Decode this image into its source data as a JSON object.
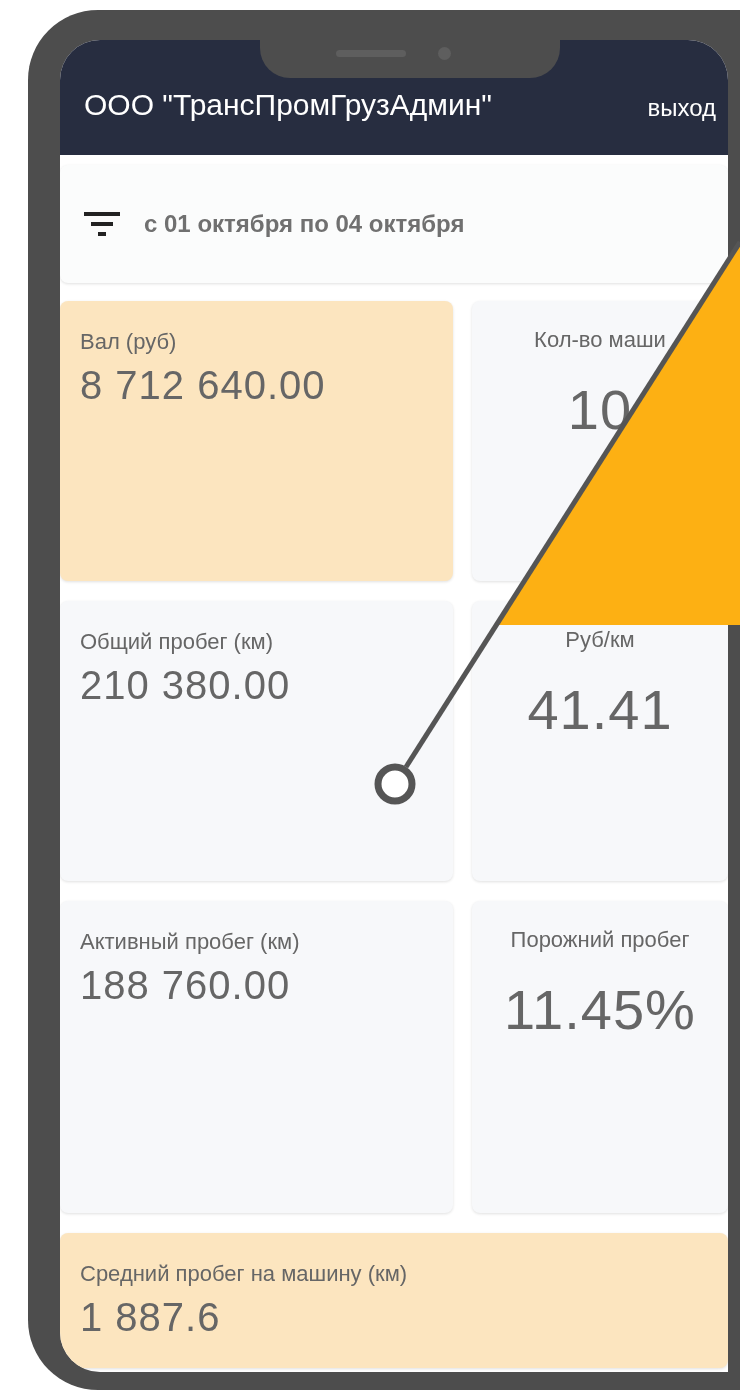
{
  "header": {
    "title": "ООО \"ТрансПромГрузАдмин\"",
    "logout": "выход"
  },
  "filter": {
    "period": "с 01 октября по 04 октября"
  },
  "cards": [
    {
      "label": "Вал (руб)",
      "value": "8 712 640.00",
      "highlighted": true
    },
    {
      "label": "Кол-во маши",
      "value": "10",
      "highlighted": false
    },
    {
      "label": "Общий пробег (км)",
      "value": "210 380.00",
      "highlighted": false
    },
    {
      "label": "Руб/км",
      "value": "41.41",
      "highlighted": false
    },
    {
      "label": "Активный пробег (км)",
      "value": "188 760.00",
      "highlighted": false
    },
    {
      "label": "Порожний пробег",
      "value": "11.45%",
      "highlighted": false
    }
  ],
  "summary": {
    "label": "Средний пробег на машину (км)",
    "value": "1 887.6",
    "highlighted": true
  }
}
